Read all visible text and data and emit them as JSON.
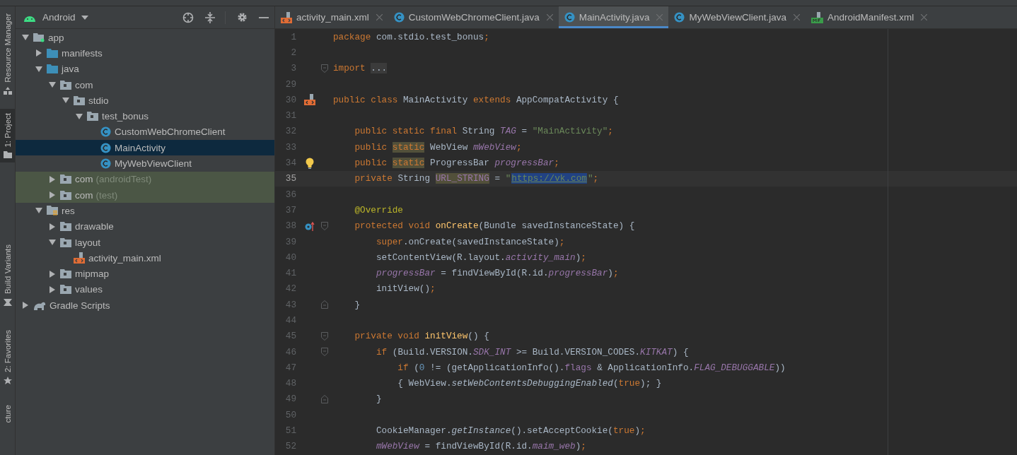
{
  "tool_stripe": [
    {
      "label": "Resource Manager",
      "kind": "resource",
      "selected": false
    },
    {
      "label": "1: Project",
      "kind": "project",
      "selected": true
    },
    {
      "label": "Build Variants",
      "kind": "build",
      "selected": false
    },
    {
      "label": "2: Favorites",
      "kind": "favorites",
      "selected": false
    },
    {
      "label": "cture",
      "kind": "structure",
      "selected": false
    }
  ],
  "project_panel": {
    "view": "Android",
    "tree": [
      {
        "label": "app",
        "kind": "module",
        "expanded": true,
        "selected": false,
        "test_scope": false,
        "children": [
          {
            "label": "manifests",
            "kind": "src-folder",
            "expanded": false,
            "selected": false,
            "test_scope": false
          },
          {
            "label": "java",
            "kind": "src-folder",
            "expanded": true,
            "selected": false,
            "test_scope": false,
            "children": [
              {
                "label": "com",
                "kind": "package",
                "expanded": true,
                "selected": false,
                "test_scope": false,
                "children": [
                  {
                    "label": "stdio",
                    "kind": "package",
                    "expanded": true,
                    "selected": false,
                    "test_scope": false,
                    "children": [
                      {
                        "label": "test_bonus",
                        "kind": "package",
                        "expanded": true,
                        "selected": false,
                        "test_scope": false,
                        "children": [
                          {
                            "label": "CustomWebChromeClient",
                            "kind": "class",
                            "selected": false,
                            "test_scope": false
                          },
                          {
                            "label": "MainActivity",
                            "kind": "class",
                            "selected": true,
                            "test_scope": false
                          },
                          {
                            "label": "MyWebViewClient",
                            "kind": "class",
                            "selected": false,
                            "test_scope": false
                          }
                        ]
                      }
                    ]
                  }
                ]
              },
              {
                "label": "com",
                "suffix": "(androidTest)",
                "kind": "package",
                "expanded": false,
                "selected": false,
                "test_scope": true
              },
              {
                "label": "com",
                "suffix": "(test)",
                "kind": "package",
                "expanded": false,
                "selected": false,
                "test_scope": true
              }
            ]
          },
          {
            "label": "res",
            "kind": "res-folder",
            "expanded": true,
            "selected": false,
            "test_scope": false,
            "children": [
              {
                "label": "drawable",
                "kind": "package",
                "expanded": false,
                "selected": false,
                "test_scope": false
              },
              {
                "label": "layout",
                "kind": "package",
                "expanded": true,
                "selected": false,
                "test_scope": false,
                "children": [
                  {
                    "label": "activity_main.xml",
                    "kind": "xml",
                    "selected": false,
                    "test_scope": false
                  }
                ]
              },
              {
                "label": "mipmap",
                "kind": "package",
                "expanded": false,
                "selected": false,
                "test_scope": false
              },
              {
                "label": "values",
                "kind": "package",
                "expanded": false,
                "selected": false,
                "test_scope": false
              }
            ]
          }
        ]
      },
      {
        "label": "Gradle Scripts",
        "kind": "gradle",
        "expanded": false,
        "selected": false,
        "test_scope": false
      }
    ]
  },
  "tabs": [
    {
      "label": "activity_main.xml",
      "kind": "xml",
      "selected": false
    },
    {
      "label": "CustomWebChromeClient.java",
      "kind": "class",
      "selected": false
    },
    {
      "label": "MainActivity.java",
      "kind": "class",
      "selected": true
    },
    {
      "label": "MyWebViewClient.java",
      "kind": "class",
      "selected": false
    },
    {
      "label": "AndroidManifest.xml",
      "kind": "manifest",
      "selected": false
    }
  ],
  "editor": {
    "lines": [
      {
        "number": "1",
        "current": false,
        "tokens": [
          {
            "text": "package",
            "kind": "kw"
          },
          {
            "text": " com.stdio.test_bonus",
            "kind": "id"
          },
          {
            "text": ";",
            "kind": "kw"
          }
        ]
      },
      {
        "number": "2",
        "current": false
      },
      {
        "number": "3",
        "current": false,
        "fold": {
          "kind": "start"
        },
        "tokens": [
          {
            "text": "import ",
            "kind": "kw"
          },
          {
            "text": "...",
            "kind": "folded"
          }
        ]
      },
      {
        "number": "29",
        "current": false
      },
      {
        "number": "30",
        "current": false,
        "marker": {
          "kind": "layout"
        },
        "tokens": [
          {
            "text": "public class ",
            "kind": "kw"
          },
          {
            "text": "MainActivity ",
            "kind": "id"
          },
          {
            "text": "extends ",
            "kind": "kw"
          },
          {
            "text": "AppCompatActivity {",
            "kind": "id"
          }
        ]
      },
      {
        "number": "31",
        "current": false
      },
      {
        "number": "32",
        "current": false,
        "tokens": [
          {
            "text": "    public static final ",
            "kind": "kw"
          },
          {
            "text": "String ",
            "kind": "id"
          },
          {
            "text": "TAG",
            "kind": "field"
          },
          {
            "text": " = ",
            "kind": "id"
          },
          {
            "text": "\"MainActivity\"",
            "kind": "str"
          },
          {
            "text": ";",
            "kind": "kw"
          }
        ]
      },
      {
        "number": "33",
        "current": false,
        "tokens": [
          {
            "text": "    public ",
            "kind": "kw"
          },
          {
            "text": "static",
            "kind": "hl_kw"
          },
          {
            "text": " WebView ",
            "kind": "id"
          },
          {
            "text": "mWebView",
            "kind": "field"
          },
          {
            "text": ";",
            "kind": "kw"
          }
        ]
      },
      {
        "number": "34",
        "current": false,
        "marker": {
          "kind": "bulb"
        },
        "tokens": [
          {
            "text": "    public ",
            "kind": "kw"
          },
          {
            "text": "static",
            "kind": "hl_kw"
          },
          {
            "text": " ProgressBar ",
            "kind": "id"
          },
          {
            "text": "progressBar",
            "kind": "field"
          },
          {
            "text": ";",
            "kind": "kw"
          }
        ]
      },
      {
        "number": "35",
        "current": true,
        "tokens": [
          {
            "text": "    private ",
            "kind": "kw"
          },
          {
            "text": "String ",
            "kind": "id"
          },
          {
            "text": "URL_STRING",
            "kind": "hl_field"
          },
          {
            "text": " = ",
            "kind": "id"
          },
          {
            "text": "\"",
            "kind": "str"
          },
          {
            "text": "https://vk.com",
            "kind": "link"
          },
          {
            "text": "\"",
            "kind": "str"
          },
          {
            "text": ";",
            "kind": "kw"
          }
        ]
      },
      {
        "number": "36",
        "current": false
      },
      {
        "number": "37",
        "current": false,
        "tokens": [
          {
            "text": "    @Override",
            "kind": "ann"
          }
        ]
      },
      {
        "number": "38",
        "current": false,
        "marker": {
          "kind": "override"
        },
        "fold": {
          "kind": "start"
        },
        "tokens": [
          {
            "text": "    protected void ",
            "kind": "kw"
          },
          {
            "text": "onCreate",
            "kind": "method"
          },
          {
            "text": "(Bundle savedInstanceState) {",
            "kind": "id"
          }
        ]
      },
      {
        "number": "39",
        "current": false,
        "tokens": [
          {
            "text": "        super",
            "kind": "kw"
          },
          {
            "text": ".onCreate(savedInstanceState)",
            "kind": "id"
          },
          {
            "text": ";",
            "kind": "kw"
          }
        ]
      },
      {
        "number": "40",
        "current": false,
        "tokens": [
          {
            "text": "        setContentView(R.layout.",
            "kind": "id"
          },
          {
            "text": "activity_main",
            "kind": "field"
          },
          {
            "text": ")",
            "kind": "id"
          },
          {
            "text": ";",
            "kind": "kw"
          }
        ]
      },
      {
        "number": "41",
        "current": false,
        "tokens": [
          {
            "text": "        progressBar",
            "kind": "field"
          },
          {
            "text": " = findViewById(R.id.",
            "kind": "id"
          },
          {
            "text": "progressBar",
            "kind": "field"
          },
          {
            "text": ")",
            "kind": "id"
          },
          {
            "text": ";",
            "kind": "kw"
          }
        ]
      },
      {
        "number": "42",
        "current": false,
        "tokens": [
          {
            "text": "        initView()",
            "kind": "id"
          },
          {
            "text": ";",
            "kind": "kw"
          }
        ]
      },
      {
        "number": "43",
        "current": false,
        "fold": {
          "kind": "end"
        },
        "tokens": [
          {
            "text": "    }",
            "kind": "id"
          }
        ]
      },
      {
        "number": "44",
        "current": false
      },
      {
        "number": "45",
        "current": false,
        "fold": {
          "kind": "start"
        },
        "tokens": [
          {
            "text": "    private void ",
            "kind": "kw"
          },
          {
            "text": "initView",
            "kind": "method"
          },
          {
            "text": "() {",
            "kind": "id"
          }
        ]
      },
      {
        "number": "46",
        "current": false,
        "fold": {
          "kind": "start"
        },
        "tokens": [
          {
            "text": "        if ",
            "kind": "kw"
          },
          {
            "text": "(Build.VERSION.",
            "kind": "id"
          },
          {
            "text": "SDK_INT",
            "kind": "field"
          },
          {
            "text": " >= Build.VERSION_CODES.",
            "kind": "id"
          },
          {
            "text": "KITKAT",
            "kind": "field"
          },
          {
            "text": ") {",
            "kind": "id"
          }
        ]
      },
      {
        "number": "47",
        "current": false,
        "tokens": [
          {
            "text": "            if ",
            "kind": "kw"
          },
          {
            "text": "(",
            "kind": "id"
          },
          {
            "text": "0",
            "kind": "num"
          },
          {
            "text": " != (getApplicationInfo().",
            "kind": "id"
          },
          {
            "text": "flags",
            "kind": "plain_field"
          },
          {
            "text": " & ApplicationInfo.",
            "kind": "id"
          },
          {
            "text": "FLAG_DEBUGGABLE",
            "kind": "field"
          },
          {
            "text": "))",
            "kind": "id"
          }
        ]
      },
      {
        "number": "48",
        "current": false,
        "tokens": [
          {
            "text": "            { WebView.",
            "kind": "id"
          },
          {
            "text": "setWebContentsDebuggingEnabled",
            "kind": "static"
          },
          {
            "text": "(",
            "kind": "id"
          },
          {
            "text": "true",
            "kind": "kw"
          },
          {
            "text": "); }",
            "kind": "id"
          }
        ]
      },
      {
        "number": "49",
        "current": false,
        "fold": {
          "kind": "end"
        },
        "tokens": [
          {
            "text": "        }",
            "kind": "id"
          }
        ]
      },
      {
        "number": "50",
        "current": false
      },
      {
        "number": "51",
        "current": false,
        "tokens": [
          {
            "text": "        CookieManager.",
            "kind": "id"
          },
          {
            "text": "getInstance",
            "kind": "static"
          },
          {
            "text": "().setAcceptCookie(",
            "kind": "id"
          },
          {
            "text": "true",
            "kind": "kw"
          },
          {
            "text": ")",
            "kind": "id"
          },
          {
            "text": ";",
            "kind": "kw"
          }
        ]
      },
      {
        "number": "52",
        "current": false,
        "tokens": [
          {
            "text": "        mWebView",
            "kind": "field"
          },
          {
            "text": " = findViewById(R.id.",
            "kind": "id"
          },
          {
            "text": "maim_web",
            "kind": "field"
          },
          {
            "text": ")",
            "kind": "id"
          },
          {
            "text": ";",
            "kind": "kw"
          }
        ]
      }
    ]
  }
}
